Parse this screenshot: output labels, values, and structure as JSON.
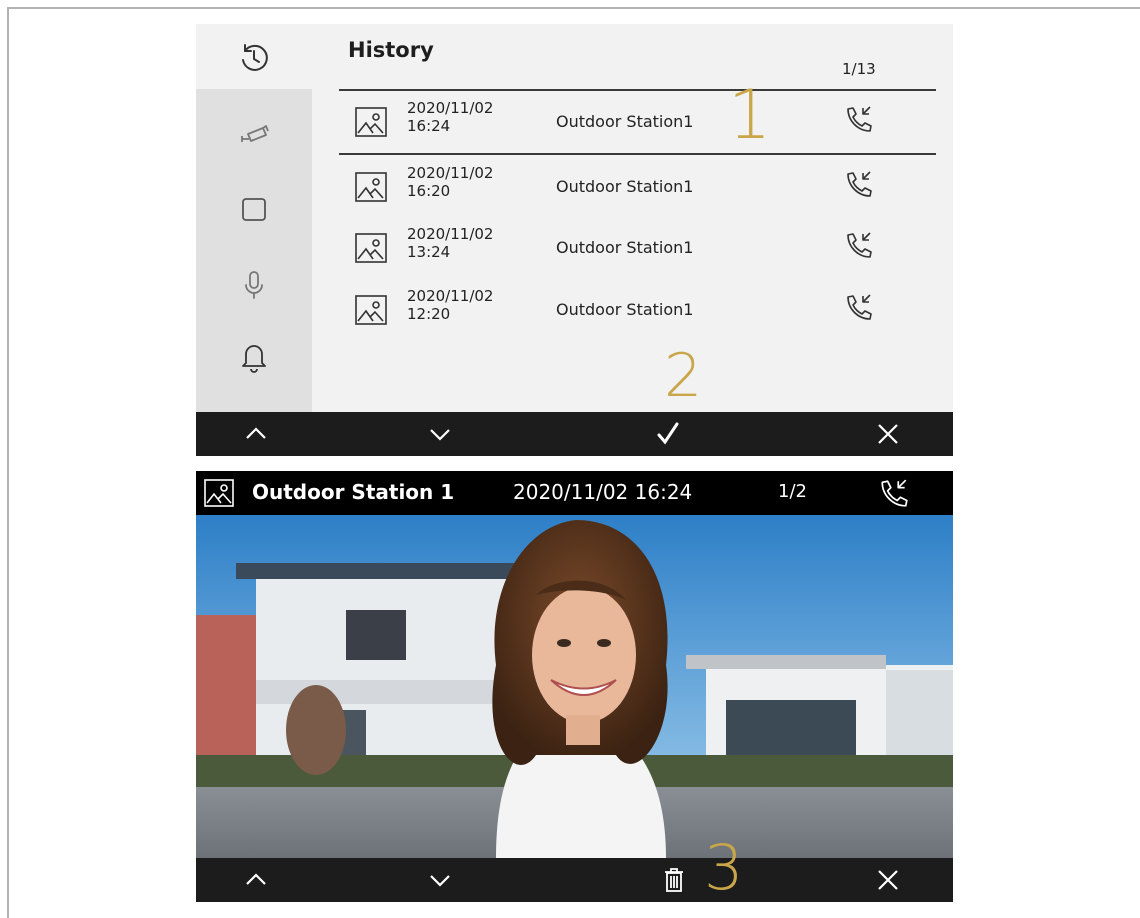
{
  "sidebar": {
    "icons": [
      "history-icon",
      "camera-icon",
      "square-icon",
      "microphone-icon",
      "bell-icon"
    ]
  },
  "history": {
    "title": "History",
    "page": "1/13",
    "rows": [
      {
        "date": "2020/11/02",
        "time": "16:24",
        "station": "Outdoor Station1",
        "icon": "incoming-call-icon"
      },
      {
        "date": "2020/11/02",
        "time": "16:20",
        "station": "Outdoor Station1",
        "icon": "incoming-call-icon"
      },
      {
        "date": "2020/11/02",
        "time": "13:24",
        "station": "Outdoor Station1",
        "icon": "incoming-call-icon"
      },
      {
        "date": "2020/11/02",
        "time": "12:20",
        "station": "Outdoor Station1",
        "icon": "incoming-call-icon"
      }
    ]
  },
  "markers": {
    "one": "1",
    "two": "2",
    "three": "3"
  },
  "bottombar1": {
    "buttons": [
      "chevron-up-icon",
      "chevron-down-icon",
      "check-icon",
      "close-icon"
    ]
  },
  "detail": {
    "station": "Outdoor Station 1",
    "datetime": "2020/11/02 16:24",
    "page": "1/2",
    "icon": "incoming-call-icon"
  },
  "bottombar2": {
    "buttons": [
      "chevron-up-icon",
      "chevron-down-icon",
      "trash-icon",
      "close-icon"
    ]
  },
  "colors": {
    "marker": "#c9a64a",
    "bar": "#1c1c1c",
    "panel": "#f2f2f2",
    "sidebar_selected": "#e0e0e0"
  }
}
